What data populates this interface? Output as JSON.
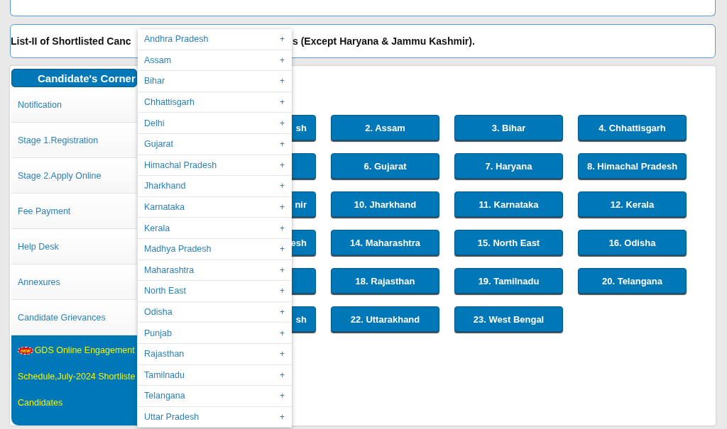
{
  "heading": {
    "before": "List-II of Shortlisted Canc",
    "after": "s (Except Haryana & Jammu Kashmir)."
  },
  "sidebar": {
    "title": "Candidate's Corner",
    "items": [
      {
        "label": "Notification"
      },
      {
        "label": "Stage 1.Registration"
      },
      {
        "label": "Stage 2.Apply Online"
      },
      {
        "label": "Fee Payment"
      },
      {
        "label": "Help Desk"
      },
      {
        "label": "Annexures"
      },
      {
        "label": "Candidate Grievances"
      }
    ],
    "notice": {
      "badge": "new",
      "lines": [
        "GDS Online Engagement",
        "Schedule,July-2024 Shortliste",
        "Candidates"
      ]
    }
  },
  "state_buttons": [
    {
      "kind": "cut",
      "label": "sh"
    },
    {
      "kind": "full",
      "label": "2. Assam"
    },
    {
      "kind": "full",
      "label": "3. Bihar"
    },
    {
      "kind": "full",
      "label": "4. Chhattisgarh"
    },
    {
      "kind": "cut"
    },
    {
      "kind": "full",
      "label": "6. Gujarat"
    },
    {
      "kind": "full",
      "label": "7. Haryana"
    },
    {
      "kind": "full",
      "label": "8. Himachal Pradesh"
    },
    {
      "kind": "cut",
      "label": "nir"
    },
    {
      "kind": "full",
      "label": "10. Jharkhand"
    },
    {
      "kind": "full",
      "label": "11. Karnataka"
    },
    {
      "kind": "full",
      "label": "12. Kerala"
    },
    {
      "kind": "cut",
      "label": "esh"
    },
    {
      "kind": "full",
      "label": "14. Maharashtra"
    },
    {
      "kind": "full",
      "label": "15. North East"
    },
    {
      "kind": "full",
      "label": "16. Odisha"
    },
    {
      "kind": "cut"
    },
    {
      "kind": "full",
      "label": "18. Rajasthan"
    },
    {
      "kind": "full",
      "label": "19. Tamilnadu"
    },
    {
      "kind": "full",
      "label": "20. Telangana"
    },
    {
      "kind": "cut",
      "label": "sh"
    },
    {
      "kind": "full",
      "label": "22. Uttarakhand"
    },
    {
      "kind": "full",
      "label": "23. West Bengal"
    }
  ],
  "dropdown": {
    "items": [
      {
        "label": "Andhra Pradesh",
        "icon": "+"
      },
      {
        "label": "Assam",
        "icon": "+"
      },
      {
        "label": "Bihar",
        "icon": "+"
      },
      {
        "label": "Chhattisgarh",
        "icon": "+"
      },
      {
        "label": "Delhi",
        "icon": "+"
      },
      {
        "label": "Gujarat",
        "icon": "+"
      },
      {
        "label": "Himachal Pradesh",
        "icon": "+"
      },
      {
        "label": "Jharkhand",
        "icon": "+"
      },
      {
        "label": "Karnataka",
        "icon": "+"
      },
      {
        "label": "Kerala",
        "icon": "+"
      },
      {
        "label": "Madhya Pradesh",
        "icon": "+"
      },
      {
        "label": "Maharashtra",
        "icon": "+"
      },
      {
        "label": "North East",
        "icon": "+"
      },
      {
        "label": "Odisha",
        "icon": "+"
      },
      {
        "label": "Punjab",
        "icon": "+"
      },
      {
        "label": "Rajasthan",
        "icon": "+"
      },
      {
        "label": "Tamilnadu",
        "icon": "+"
      },
      {
        "label": "Telangana",
        "icon": "+"
      },
      {
        "label": "Uttar Pradesh",
        "icon": "+"
      }
    ]
  }
}
